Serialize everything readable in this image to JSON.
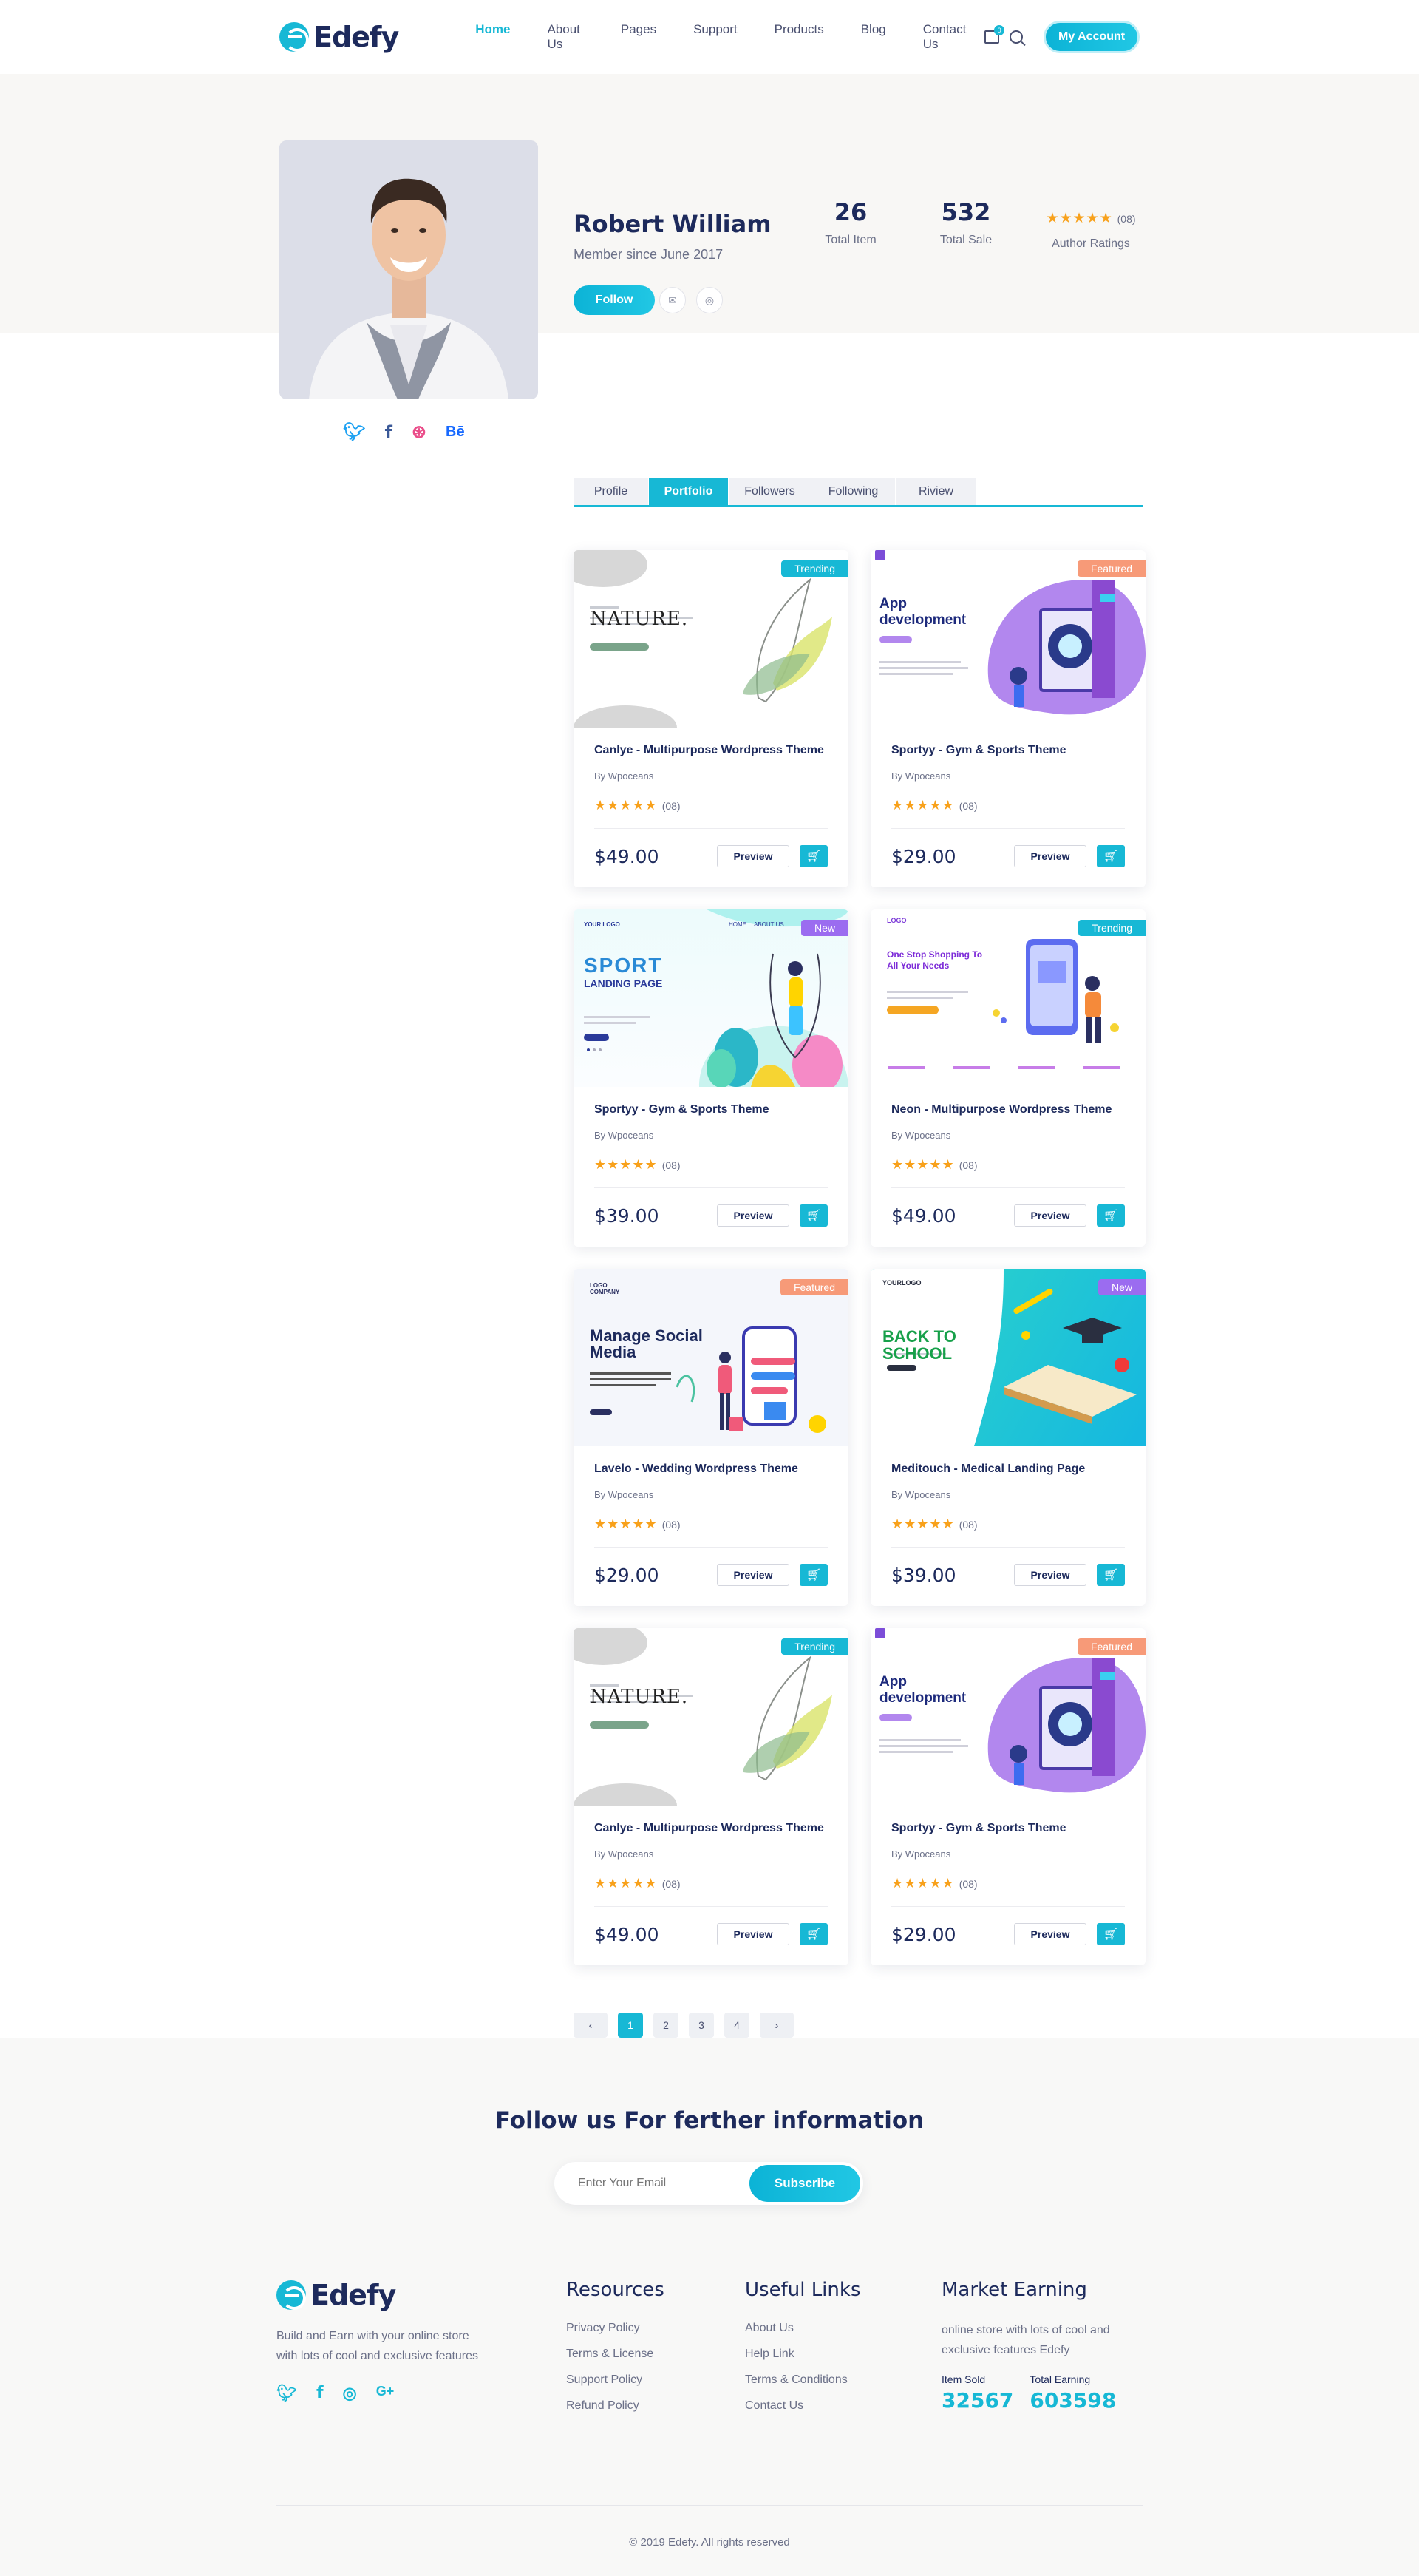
{
  "header": {
    "logo_text": "Edefy",
    "nav": [
      "Home",
      "About Us",
      "Pages",
      "Support",
      "Products",
      "Blog",
      "Contact Us"
    ],
    "cart_count": "0",
    "account_label": "My Account"
  },
  "profile": {
    "name": "Robert William",
    "member_since": "Member since June 2017",
    "follow_label": "Follow",
    "total_item": "26",
    "total_item_label": "Total Item",
    "total_sale": "532",
    "total_sale_label": "Total Sale",
    "rating_stars": "★★★★★",
    "rating_count": "(08)",
    "rating_label": "Author Ratings"
  },
  "tabs": [
    "Profile",
    "Portfolio",
    "Followers",
    "Following",
    "Riview"
  ],
  "products": [
    {
      "title": "Canlye - Multipurpose Wordpress Theme",
      "by": "By Wpoceans",
      "price": "$49.00",
      "badge": "Trending",
      "badge_color": "#17b8d5",
      "art": "nature"
    },
    {
      "title": "Sportyy - Gym & Sports Theme",
      "by": "By Wpoceans",
      "price": "$29.00",
      "badge": "Featured",
      "badge_color": "#f79a78",
      "art": "app"
    },
    {
      "title": "Sportyy - Gym & Sports Theme",
      "by": "By Wpoceans",
      "price": "$39.00",
      "badge": "New",
      "badge_color": "#9b6cf0",
      "art": "sport"
    },
    {
      "title": "Neon - Multipurpose Wordpress Theme",
      "by": "By Wpoceans",
      "price": "$49.00",
      "badge": "Trending",
      "badge_color": "#17b8d5",
      "art": "neon"
    },
    {
      "title": "Lavelo - Wedding Wordpress Theme",
      "by": "By Wpoceans",
      "price": "$29.00",
      "badge": "Featured",
      "badge_color": "#f79a78",
      "art": "social"
    },
    {
      "title": "Meditouch - Medical Landing Page",
      "by": "By Wpoceans",
      "price": "$39.00",
      "badge": "New",
      "badge_color": "#9b6cf0",
      "art": "school"
    },
    {
      "title": "Canlye - Multipurpose Wordpress Theme",
      "by": "By Wpoceans",
      "price": "$49.00",
      "badge": "Trending",
      "badge_color": "#17b8d5",
      "art": "nature"
    },
    {
      "title": "Sportyy - Gym & Sports Theme",
      "by": "By Wpoceans",
      "price": "$29.00",
      "badge": "Featured",
      "badge_color": "#f79a78",
      "art": "app"
    }
  ],
  "product_common": {
    "stars": "★★★★★",
    "rating_count": "(08)",
    "preview_label": "Preview"
  },
  "art_text": {
    "nature_word": "NATURE.",
    "app_word": "App development",
    "sport_word1": "SPORT",
    "sport_word2": "LANDING PAGE",
    "sport_logo": "YOUR LOGO",
    "sport_nav": [
      "HOME",
      "ABOUT US"
    ],
    "neon_logo": "LOGO",
    "neon_text": "One Stop Shopping To All Your Needs",
    "social_logo": "LOGO COMPANY",
    "social_word": "Manage Social Media",
    "school_logo": "YOURLOGO",
    "school_word": "BACK TO SCHOOL"
  },
  "pagination": [
    "1",
    "2",
    "3",
    "4"
  ],
  "newsletter": {
    "heading": "Follow us For ferther information",
    "placeholder": "Enter Your Email",
    "button": "Subscribe"
  },
  "footer": {
    "logo_text": "Edefy",
    "about": "Build and Earn with your online store with lots of cool and exclusive features",
    "resources_title": "Resources",
    "resources": [
      "Privacy Policy",
      "Terms & License",
      "Support Policy",
      "Refund Policy"
    ],
    "useful_title": "Useful Links",
    "useful": [
      "About Us",
      "Help Link",
      "Terms & Conditions",
      "Contact Us"
    ],
    "market_title": "Market Earning",
    "market_text": "online store with lots of cool and exclusive features Edefy",
    "item_sold_label": "Item Sold",
    "item_sold": "32567",
    "total_earning_label": "Total Earning",
    "total_earning": "603598",
    "copyright": "© 2019 Edefy. All rights reserved"
  },
  "colors": {
    "accent": "#17b8d5",
    "navy": "#1d2a5c",
    "star": "#f8a11b"
  }
}
